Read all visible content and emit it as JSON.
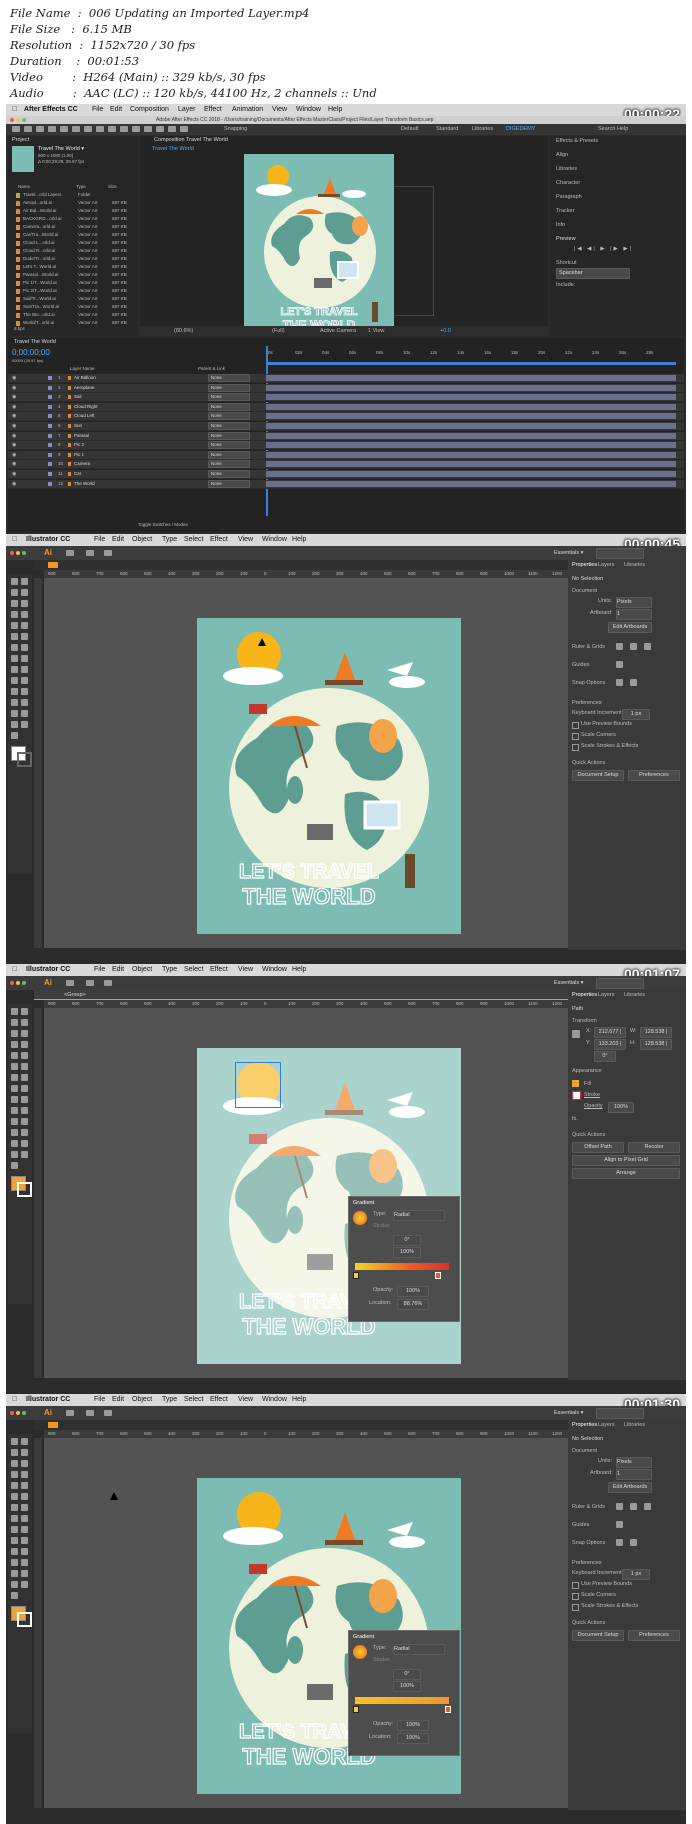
{
  "header": {
    "lines": [
      "File Name  :  006 Updating an Imported Layer.mp4",
      "File Size   :  6.15 MB",
      "Resolution  :  1152x720 / 30 fps",
      "Duration    :  00:01:53",
      "Video        :  H264 (Main) :: 329 kb/s, 30 fps",
      "Audio        :  AAC (LC) :: 120 kb/s, 44100 Hz, 2 channels :: Und"
    ]
  },
  "ae": {
    "timestamp": "00:00:22",
    "menu": [
      "After Effects CC",
      "File",
      "Edit",
      "Composition",
      "Layer",
      "Effect",
      "Animation",
      "View",
      "Window",
      "Help"
    ],
    "window_title": "Adobe After Effects CC 2018 - /Users/training/Documents/After Effects MasterClass/Project Files/Layer Transform Basics.aep",
    "workspaces": [
      "Default",
      "Standard",
      "Libraries",
      "DIGEDEMY"
    ],
    "search": "Search Help",
    "snapping": "Snapping",
    "project_title": "Project",
    "comp_name": "Travel The World ▾",
    "comp_info_1": "900 x 1080 (1.00)",
    "comp_info_2": "Δ 0;00;29;29, 29.97 fps",
    "project_cols": [
      "Name",
      "Type",
      "Size"
    ],
    "project_items": [
      {
        "name": "Travel...orld Layers",
        "type": "Folder",
        "size": ""
      },
      {
        "name": "Aeropl...orld.ai",
        "type": "Vector Art",
        "size": "697 KB"
      },
      {
        "name": "Air Bal...World.ai",
        "type": "Vector Art",
        "size": "697 KB"
      },
      {
        "name": "BACKGRO...orld.ai",
        "type": "Vector Art",
        "size": "697 KB"
      },
      {
        "name": "Camera...orld.ai",
        "type": "Vector Art",
        "size": "697 KB"
      },
      {
        "name": "Car/Tra...World.ai",
        "type": "Vector Art",
        "size": "697 KB"
      },
      {
        "name": "Cloud L...orld.ai",
        "type": "Vector Art",
        "size": "697 KB"
      },
      {
        "name": "Cloud R...orld.ai",
        "type": "Vector Art",
        "size": "697 KB"
      },
      {
        "name": "Dude/Tr...orld.ai",
        "type": "Vector Art",
        "size": "697 KB"
      },
      {
        "name": "Let's T...World.ai",
        "type": "Vector Art",
        "size": "697 KB"
      },
      {
        "name": "Parasol...World.ai",
        "type": "Vector Art",
        "size": "697 KB"
      },
      {
        "name": "Pic 1/T...World.ai",
        "type": "Vector Art",
        "size": "697 KB"
      },
      {
        "name": "Pic 2/T...World.ai",
        "type": "Vector Art",
        "size": "697 KB"
      },
      {
        "name": "Sail/Tr...World.ai",
        "type": "Vector Art",
        "size": "697 KB"
      },
      {
        "name": "Sun/Tra...World.ai",
        "type": "Vector Art",
        "size": "697 KB"
      },
      {
        "name": "The Wo...orld.ai",
        "type": "Vector Art",
        "size": "697 KB"
      },
      {
        "name": "World/T...orld.ai",
        "type": "Vector Art",
        "size": "697 KB"
      }
    ],
    "bpc": "8 bpc",
    "comp_tab": "Composition Travel The World",
    "comp_subtab": "Travel The World",
    "viewer_zoom": "(80.6%)",
    "viewer_res": "(Full)",
    "viewer_camera": "Active Camera",
    "viewer_view": "1 View",
    "viewer_exposure": "+0.0",
    "right_panels": [
      "Effects & Presets",
      "Align",
      "Libraries",
      "Character",
      "Paragraph",
      "Tracker",
      "Info",
      "Preview",
      "Shortcut",
      "Spacebar",
      "Include:"
    ],
    "timeline_tab": "Travel The World",
    "timecode": "0;00;00;00",
    "timecode_sub": "00000 (29.97 fps)",
    "tl_cols": [
      "Layer Name",
      "Parent & Link"
    ],
    "layers": [
      {
        "num": "1",
        "name": "Air Balloon",
        "parent": "None"
      },
      {
        "num": "2",
        "name": "Aeroplane",
        "parent": "None"
      },
      {
        "num": "3",
        "name": "Sail",
        "parent": "None"
      },
      {
        "num": "4",
        "name": "Cloud Right",
        "parent": "None"
      },
      {
        "num": "5",
        "name": "Cloud Left",
        "parent": "None"
      },
      {
        "num": "6",
        "name": "Sun",
        "parent": "None"
      },
      {
        "num": "7",
        "name": "Parasol",
        "parent": "None"
      },
      {
        "num": "8",
        "name": "Pic 2",
        "parent": "None"
      },
      {
        "num": "9",
        "name": "Pic 1",
        "parent": "None"
      },
      {
        "num": "10",
        "name": "Camera",
        "parent": "None"
      },
      {
        "num": "11",
        "name": "Car",
        "parent": "None"
      },
      {
        "num": "12",
        "name": "The World",
        "parent": "None"
      }
    ],
    "ruler_marks": [
      "0s",
      "02s",
      "04s",
      "06s",
      "08s",
      "10s",
      "12s",
      "14s",
      "16s",
      "18s",
      "20s",
      "22s",
      "24s",
      "26s",
      "28s"
    ],
    "toggle_label": "Toggle Switches / Modes"
  },
  "ai": {
    "app_name": "Illustrator CC",
    "menu": [
      "File",
      "Edit",
      "Object",
      "Type",
      "Select",
      "Effect",
      "View",
      "Window",
      "Help"
    ],
    "essentials": "Essentials ▾",
    "panel_tabs": [
      "Properties",
      "Layers",
      "Libraries"
    ],
    "ruler_nums": [
      "900",
      "800",
      "700",
      "600",
      "500",
      "400",
      "300",
      "200",
      "100",
      "0",
      "100",
      "200",
      "300",
      "400",
      "500",
      "600",
      "700",
      "800",
      "900",
      "1000",
      "1100",
      "1200"
    ],
    "poster_text_1": "LET'S TRAVEL",
    "poster_text_2": "THE WORLD",
    "doc_props": {
      "no_selection": "No Selection",
      "document": "Document",
      "units_label": "Units:",
      "units_value": "Pixels",
      "artboard_label": "Artboard:",
      "artboard_value": "1",
      "edit_artboards": "Edit Artboards",
      "rulers": "Ruler & Grids",
      "guides": "Guides",
      "snap": "Snap Options",
      "preferences": "Preferences",
      "keyboard_inc": "Keyboard Increment:",
      "keyboard_val": "1 px",
      "cb1": "Use Preview Bounds",
      "cb2": "Scale Corners",
      "cb3": "Scale Strokes & Effects",
      "quick_actions": "Quick Actions",
      "doc_setup": "Document Setup",
      "prefs_btn": "Preferences"
    },
    "path_props": {
      "path": "Path",
      "transform": "Transform",
      "x_label": "X:",
      "x_val": "212.677 |",
      "y_label": "Y:",
      "y_val": "133.203 |",
      "w_label": "W:",
      "w_val": "128.538 |",
      "h_label": "H:",
      "h_val": "128.538 |",
      "angle": "0°",
      "appearance": "Appearance",
      "fill": "Fill",
      "stroke": "Stroke",
      "opacity_label": "Opacity",
      "opacity_val": "100%",
      "fx": "fx.",
      "quick_actions": "Quick Actions",
      "offset_path": "Offset Path",
      "recolor": "Recolor",
      "align_pixel": "Align to Pixel Grid",
      "arrange": "Arrange"
    },
    "breadcrumb": "<Group>",
    "gradient": {
      "title": "Gradient",
      "type_label": "Type:",
      "type_val": "Radial",
      "stroke_label": "Stroke:",
      "angle_val": "0°",
      "ratio_val": "100%",
      "opacity_label": "Opacity:",
      "location_label": "Location:"
    },
    "frames": [
      {
        "timestamp": "00:00:45",
        "location": "",
        "opacity": ""
      },
      {
        "timestamp": "00:01:07",
        "location": "88.76%",
        "opacity": "100%"
      },
      {
        "timestamp": "00:01:30",
        "location": "100%",
        "opacity": "100%"
      }
    ]
  },
  "colors": {
    "poster_bg": "#7dbcb3",
    "globe": "#eef2dc",
    "land": "#5e9e92",
    "sun": "#f7b519",
    "orange": "#ee7b22",
    "app_bg": "#2b2b2b"
  }
}
